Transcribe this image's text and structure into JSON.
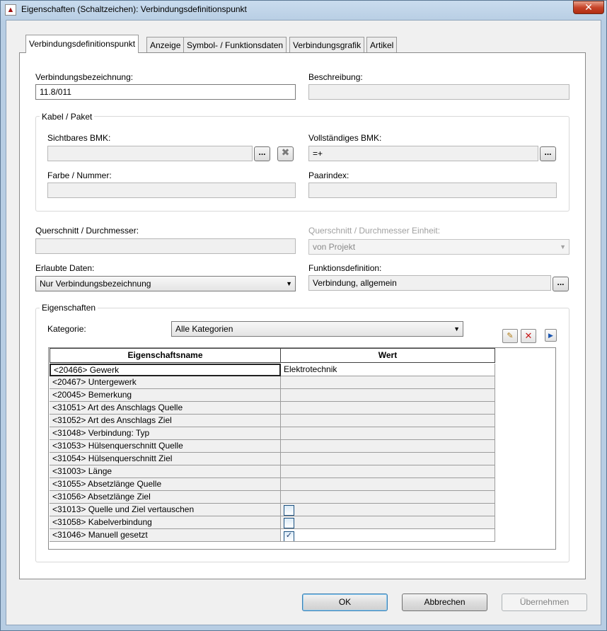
{
  "window": {
    "title": "Eigenschaften (Schaltzeichen): Verbindungsdefinitionspunkt",
    "icon": "eplan-app-icon",
    "close_label": "✕"
  },
  "tabs": [
    {
      "label": "Verbindungsdefinitionspunkt",
      "active": true
    },
    {
      "label": "Anzeige",
      "active": false
    },
    {
      "label": "Symbol- / Funktionsdaten",
      "active": false
    },
    {
      "label": "Verbindungsgrafik",
      "active": false
    },
    {
      "label": "Artikel",
      "active": false
    }
  ],
  "form": {
    "verbindungsbezeichnung": {
      "label": "Verbindungsbezeichnung:",
      "value": "11.8/011"
    },
    "beschreibung": {
      "label": "Beschreibung:",
      "value": ""
    },
    "kabel_group": {
      "title": "Kabel / Paket",
      "sichtbares_bmk": {
        "label": "Sichtbares BMK:",
        "value": ""
      },
      "vollstaendiges_bmk": {
        "label": "Vollständiges BMK:",
        "value": "=+"
      },
      "farbe_nummer": {
        "label": "Farbe / Nummer:",
        "value": ""
      },
      "paarindex": {
        "label": "Paarindex:",
        "value": ""
      }
    },
    "querschnitt": {
      "label": "Querschnitt / Durchmesser:",
      "value": ""
    },
    "querschnitt_einheit": {
      "label": "Querschnitt / Durchmesser Einheit:",
      "value": "von Projekt"
    },
    "erlaubte_daten": {
      "label": "Erlaubte Daten:",
      "value": "Nur Verbindungsbezeichnung"
    },
    "funktionsdefinition": {
      "label": "Funktionsdefinition:",
      "value": "Verbindung, allgemein"
    },
    "ellipsis": "..."
  },
  "properties": {
    "title": "Eigenschaften",
    "kategorie_label": "Kategorie:",
    "kategorie_value": "Alle Kategorien",
    "columns": [
      "Eigenschaftsname",
      "Wert"
    ],
    "rows": [
      {
        "name": "<20466> Gewerk",
        "value": "Elektrotechnik"
      },
      {
        "name": "<20467> Untergewerk",
        "value": ""
      },
      {
        "name": "<20045> Bemerkung",
        "value": ""
      },
      {
        "name": "<31051> Art des Anschlags Quelle",
        "value": ""
      },
      {
        "name": "<31052> Art des Anschlags Ziel",
        "value": ""
      },
      {
        "name": "<31048> Verbindung: Typ",
        "value": ""
      },
      {
        "name": "<31053> Hülsenquerschnitt Quelle",
        "value": ""
      },
      {
        "name": "<31054> Hülsenquerschnitt Ziel",
        "value": ""
      },
      {
        "name": "<31003> Länge",
        "value": ""
      },
      {
        "name": "<31055> Absetzlänge Quelle",
        "value": ""
      },
      {
        "name": "<31056> Absetzlänge Ziel",
        "value": ""
      },
      {
        "name": "<31013> Quelle und Ziel vertauschen",
        "value": "",
        "checkbox": false
      },
      {
        "name": "<31058> Kabelverbindung",
        "value": "",
        "checkbox": false
      },
      {
        "name": "<31046> Manuell gesetzt",
        "value": "",
        "checkbox": true
      }
    ]
  },
  "buttons": {
    "ok": "OK",
    "abbrechen": "Abbrechen",
    "uebernehmen": "Übernehmen"
  }
}
